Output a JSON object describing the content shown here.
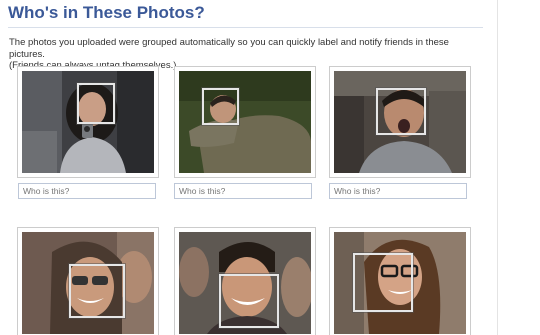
{
  "page": {
    "title": "Who's in These Photos?",
    "intro_line1": "The photos you uploaded were grouped automatically so you can quickly label and notify friends in these pictures.",
    "intro_line2": "(Friends can always untag themselves.)"
  },
  "photos": [
    {
      "name_placeholder": "Who is this?"
    },
    {
      "name_placeholder": "Who is this?"
    },
    {
      "name_placeholder": "Who is this?"
    },
    {},
    {},
    {}
  ],
  "colors": {
    "title": "#3b5998",
    "rule": "#d8dfea",
    "input_border": "#bdc7d8",
    "card_border": "#cccccc"
  }
}
